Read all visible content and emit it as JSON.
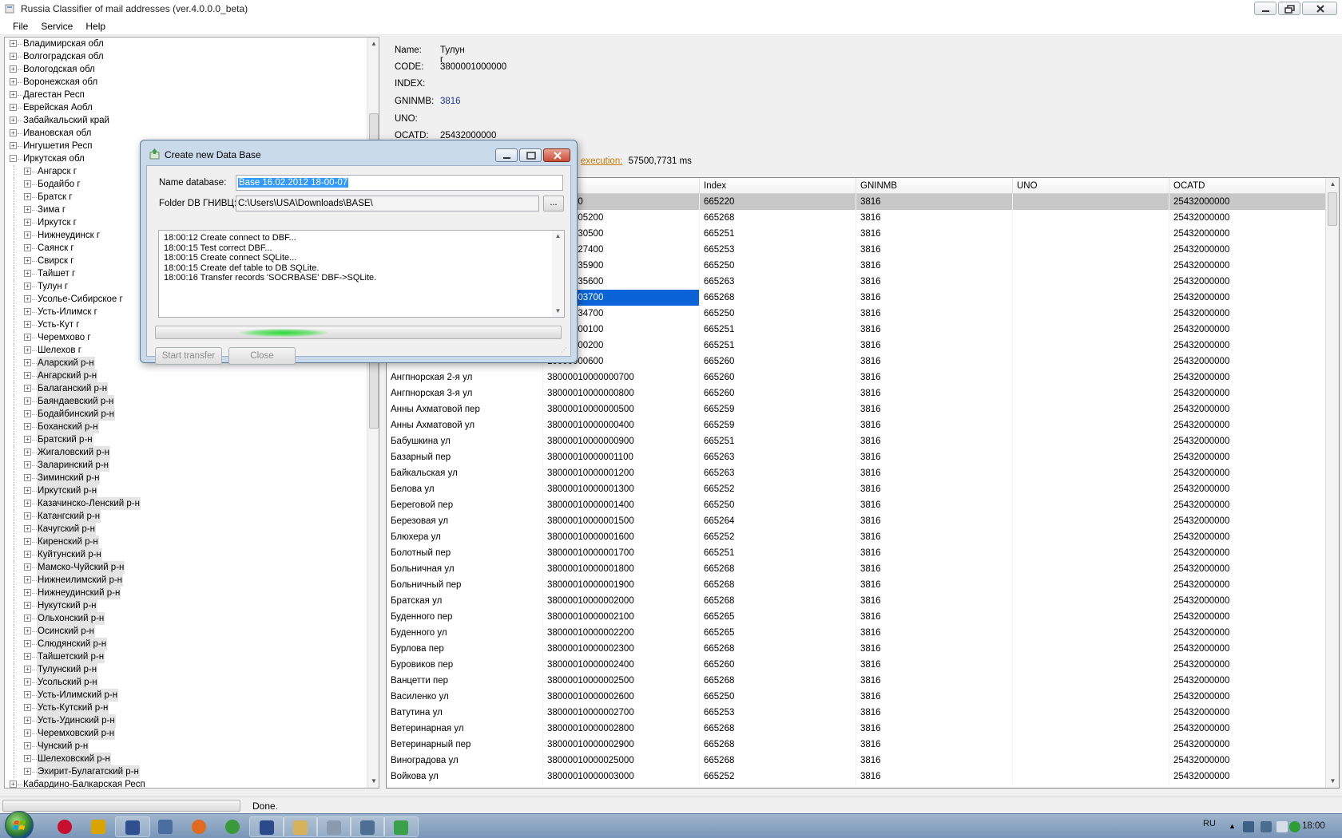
{
  "window": {
    "title": "Russia Classifier of mail addresses  (ver.4.0.0.0_beta)"
  },
  "menu": [
    "File",
    "Service",
    "Help"
  ],
  "tree": {
    "nodes": [
      {
        "label": "Владимирская обл",
        "level": 0,
        "expanded": false,
        "highlighted": false
      },
      {
        "label": "Волгоградская обл",
        "level": 0,
        "expanded": false,
        "highlighted": false
      },
      {
        "label": "Вологодская обл",
        "level": 0,
        "expanded": false,
        "highlighted": false
      },
      {
        "label": "Воронежская обл",
        "level": 0,
        "expanded": false,
        "highlighted": false
      },
      {
        "label": "Дагестан Респ",
        "level": 0,
        "expanded": false,
        "highlighted": false
      },
      {
        "label": "Еврейская Аобл",
        "level": 0,
        "expanded": false,
        "highlighted": false
      },
      {
        "label": "Забайкальский край",
        "level": 0,
        "expanded": false,
        "highlighted": false
      },
      {
        "label": "Ивановская обл",
        "level": 0,
        "expanded": false,
        "highlighted": false
      },
      {
        "label": "Ингушетия Респ",
        "level": 0,
        "expanded": false,
        "highlighted": false
      },
      {
        "label": "Иркутская обл",
        "level": 0,
        "expanded": true,
        "highlighted": false
      },
      {
        "label": "Ангарск г",
        "level": 1,
        "expanded": false,
        "highlighted": false
      },
      {
        "label": "Бодайбо г",
        "level": 1,
        "expanded": false,
        "highlighted": false
      },
      {
        "label": "Братск г",
        "level": 1,
        "expanded": false,
        "highlighted": false
      },
      {
        "label": "Зима г",
        "level": 1,
        "expanded": false,
        "highlighted": false
      },
      {
        "label": "Иркутск г",
        "level": 1,
        "expanded": false,
        "highlighted": false
      },
      {
        "label": "Нижнеудинск г",
        "level": 1,
        "expanded": false,
        "highlighted": false
      },
      {
        "label": "Саянск г",
        "level": 1,
        "expanded": false,
        "highlighted": false
      },
      {
        "label": "Свирск г",
        "level": 1,
        "expanded": false,
        "highlighted": false
      },
      {
        "label": "Тайшет г",
        "level": 1,
        "expanded": false,
        "highlighted": false
      },
      {
        "label": "Тулун г",
        "level": 1,
        "expanded": false,
        "highlighted": false
      },
      {
        "label": "Усолье-Сибирское г",
        "level": 1,
        "expanded": false,
        "highlighted": false
      },
      {
        "label": "Усть-Илимск г",
        "level": 1,
        "expanded": false,
        "highlighted": false
      },
      {
        "label": "Усть-Кут г",
        "level": 1,
        "expanded": false,
        "highlighted": false
      },
      {
        "label": "Черемхово г",
        "level": 1,
        "expanded": false,
        "highlighted": false
      },
      {
        "label": "Шелехов г",
        "level": 1,
        "expanded": false,
        "highlighted": false
      },
      {
        "label": "Аларский р-н",
        "level": 1,
        "expanded": false,
        "highlighted": true
      },
      {
        "label": "Ангарский р-н",
        "level": 1,
        "expanded": false,
        "highlighted": true
      },
      {
        "label": "Балаганский р-н",
        "level": 1,
        "expanded": false,
        "highlighted": true
      },
      {
        "label": "Баяндаевский р-н",
        "level": 1,
        "expanded": false,
        "highlighted": true
      },
      {
        "label": "Бодайбинский р-н",
        "level": 1,
        "expanded": false,
        "highlighted": true
      },
      {
        "label": "Боханский р-н",
        "level": 1,
        "expanded": false,
        "highlighted": true
      },
      {
        "label": "Братский р-н",
        "level": 1,
        "expanded": false,
        "highlighted": true
      },
      {
        "label": "Жигаловский р-н",
        "level": 1,
        "expanded": false,
        "highlighted": true
      },
      {
        "label": "Заларинский р-н",
        "level": 1,
        "expanded": false,
        "highlighted": true
      },
      {
        "label": "Зиминский р-н",
        "level": 1,
        "expanded": false,
        "highlighted": true
      },
      {
        "label": "Иркутский р-н",
        "level": 1,
        "expanded": false,
        "highlighted": true
      },
      {
        "label": "Казачинско-Ленский р-н",
        "level": 1,
        "expanded": false,
        "highlighted": true
      },
      {
        "label": "Катангский р-н",
        "level": 1,
        "expanded": false,
        "highlighted": true
      },
      {
        "label": "Качугский р-н",
        "level": 1,
        "expanded": false,
        "highlighted": true
      },
      {
        "label": "Киренский р-н",
        "level": 1,
        "expanded": false,
        "highlighted": true
      },
      {
        "label": "Куйтунский р-н",
        "level": 1,
        "expanded": false,
        "highlighted": true
      },
      {
        "label": "Мамско-Чуйский р-н",
        "level": 1,
        "expanded": false,
        "highlighted": true
      },
      {
        "label": "Нижнеилимский р-н",
        "level": 1,
        "expanded": false,
        "highlighted": true
      },
      {
        "label": "Нижнеудинский р-н",
        "level": 1,
        "expanded": false,
        "highlighted": true
      },
      {
        "label": "Нукутский р-н",
        "level": 1,
        "expanded": false,
        "highlighted": true
      },
      {
        "label": "Ольхонский р-н",
        "level": 1,
        "expanded": false,
        "highlighted": true
      },
      {
        "label": "Осинский р-н",
        "level": 1,
        "expanded": false,
        "highlighted": true
      },
      {
        "label": "Слюдянский р-н",
        "level": 1,
        "expanded": false,
        "highlighted": true
      },
      {
        "label": "Тайшетский р-н",
        "level": 1,
        "expanded": false,
        "highlighted": true
      },
      {
        "label": "Тулунский р-н",
        "level": 1,
        "expanded": false,
        "highlighted": true
      },
      {
        "label": "Усольский р-н",
        "level": 1,
        "expanded": false,
        "highlighted": true
      },
      {
        "label": "Усть-Илимский р-н",
        "level": 1,
        "expanded": false,
        "highlighted": true
      },
      {
        "label": "Усть-Кутский р-н",
        "level": 1,
        "expanded": false,
        "highlighted": true
      },
      {
        "label": "Усть-Удинский р-н",
        "level": 1,
        "expanded": false,
        "highlighted": true
      },
      {
        "label": "Черемховский р-н",
        "level": 1,
        "expanded": false,
        "highlighted": true
      },
      {
        "label": "Чунский р-н",
        "level": 1,
        "expanded": false,
        "highlighted": true
      },
      {
        "label": "Шелеховский р-н",
        "level": 1,
        "expanded": false,
        "highlighted": true
      },
      {
        "label": "Эхирит-Булагатский р-н",
        "level": 1,
        "expanded": false,
        "highlighted": true
      },
      {
        "label": "Кабардино-Балкарская Респ",
        "level": 0,
        "expanded": false,
        "highlighted": false
      }
    ]
  },
  "info": {
    "name_label": "Name:",
    "name_value": "Тулун г",
    "code_label": "CODE:",
    "code_value": "3800001000000",
    "index_label": "INDEX:",
    "index_value": "",
    "gninmb_label": "GNINMB:",
    "gninmb_value": "3816",
    "uno_label": "UNO:",
    "uno_value": "",
    "ocatd_label": "OCATD:",
    "ocatd_value": "25432000000",
    "exec_label": "execution:",
    "exec_value": "57500,7731 ms"
  },
  "grid": {
    "columns": [
      "",
      "",
      "Index",
      "GNINMB",
      "UNO",
      "OCATD"
    ],
    "rows": [
      [
        "",
        "1000100",
        "665220",
        "3816",
        "",
        "25432000000"
      ],
      [
        "",
        "10000005200",
        "665268",
        "3816",
        "",
        "25432000000"
      ],
      [
        "",
        "10000030500",
        "665251",
        "3816",
        "",
        "25432000000"
      ],
      [
        "",
        "10000027400",
        "665253",
        "3816",
        "",
        "25432000000"
      ],
      [
        "",
        "10000035900",
        "665250",
        "3816",
        "",
        "25432000000"
      ],
      [
        "",
        "10000035600",
        "665263",
        "3816",
        "",
        "25432000000"
      ],
      [
        "",
        "10000003700",
        "665268",
        "3816",
        "",
        "25432000000"
      ],
      [
        "",
        "10000034700",
        "665250",
        "3816",
        "",
        "25432000000"
      ],
      [
        "",
        "10000000100",
        "665251",
        "3816",
        "",
        "25432000000"
      ],
      [
        "",
        "10000000200",
        "665251",
        "3816",
        "",
        "25432000000"
      ],
      [
        "",
        "10000000600",
        "665260",
        "3816",
        "",
        "25432000000"
      ],
      [
        "Ангпнорская 2-я ул",
        "38000010000000700",
        "665260",
        "3816",
        "",
        "25432000000"
      ],
      [
        "Ангпнорская 3-я ул",
        "38000010000000800",
        "665260",
        "3816",
        "",
        "25432000000"
      ],
      [
        "Анны Ахматовой пер",
        "38000010000000500",
        "665259",
        "3816",
        "",
        "25432000000"
      ],
      [
        "Анны Ахматовой ул",
        "38000010000000400",
        "665259",
        "3816",
        "",
        "25432000000"
      ],
      [
        "Бабушкина ул",
        "38000010000000900",
        "665251",
        "3816",
        "",
        "25432000000"
      ],
      [
        "Базарный пер",
        "38000010000001100",
        "665263",
        "3816",
        "",
        "25432000000"
      ],
      [
        "Байкальская ул",
        "38000010000001200",
        "665263",
        "3816",
        "",
        "25432000000"
      ],
      [
        "Белова ул",
        "38000010000001300",
        "665252",
        "3816",
        "",
        "25432000000"
      ],
      [
        "Береговой пер",
        "38000010000001400",
        "665250",
        "3816",
        "",
        "25432000000"
      ],
      [
        "Березовая ул",
        "38000010000001500",
        "665264",
        "3816",
        "",
        "25432000000"
      ],
      [
        "Блюхера ул",
        "38000010000001600",
        "665252",
        "3816",
        "",
        "25432000000"
      ],
      [
        "Болотный пер",
        "38000010000001700",
        "665251",
        "3816",
        "",
        "25432000000"
      ],
      [
        "Больничная ул",
        "38000010000001800",
        "665268",
        "3816",
        "",
        "25432000000"
      ],
      [
        "Больничный пер",
        "38000010000001900",
        "665268",
        "3816",
        "",
        "25432000000"
      ],
      [
        "Братская ул",
        "38000010000002000",
        "665268",
        "3816",
        "",
        "25432000000"
      ],
      [
        "Буденного пер",
        "38000010000002100",
        "665265",
        "3816",
        "",
        "25432000000"
      ],
      [
        "Буденного ул",
        "38000010000002200",
        "665265",
        "3816",
        "",
        "25432000000"
      ],
      [
        "Бурлова пер",
        "38000010000002300",
        "665268",
        "3816",
        "",
        "25432000000"
      ],
      [
        "Буровиков пер",
        "38000010000002400",
        "665260",
        "3816",
        "",
        "25432000000"
      ],
      [
        "Ванцетти пер",
        "38000010000002500",
        "665268",
        "3816",
        "",
        "25432000000"
      ],
      [
        "Василенко ул",
        "38000010000002600",
        "665250",
        "3816",
        "",
        "25432000000"
      ],
      [
        "Ватутина ул",
        "38000010000002700",
        "665253",
        "3816",
        "",
        "25432000000"
      ],
      [
        "Ветеринарная ул",
        "38000010000002800",
        "665268",
        "3816",
        "",
        "25432000000"
      ],
      [
        "Ветеринарный пер",
        "38000010000002900",
        "665268",
        "3816",
        "",
        "25432000000"
      ],
      [
        "Виноградова ул",
        "38000010000025000",
        "665268",
        "3816",
        "",
        "25432000000"
      ],
      [
        "Войкова ул",
        "38000010000003000",
        "665252",
        "3816",
        "",
        "25432000000"
      ]
    ]
  },
  "status": {
    "text": "Done."
  },
  "dialog": {
    "title": "Create new Data Base",
    "name_label": "Name database:",
    "name_value": "Base 16.02.2012 18-00-07",
    "folder_label": "Folder DB ГНИВЦ:",
    "folder_value": "C:\\Users\\USA\\Downloads\\BASE\\",
    "browse_label": "...",
    "log": [
      "18:00:12 Create connect to DBF...",
      "18:00:15 Test correct DBF...",
      "18:00:15 Create connect SQLite...",
      "18:00:15 Create def table to DB SQLite.",
      "18:00:16 Transfer records 'SOCRBASE' DBF->SQLite."
    ],
    "start_label": "Start transfer",
    "close_label": "Close"
  },
  "taskbar": {
    "lang": "RU",
    "clock": "18:00",
    "items": [
      "opera-icon",
      "app-icon",
      "infinity-icon",
      "connection-icon",
      "firefox-icon",
      "chrome-icon",
      "save-icon",
      "folder-icon",
      "db-icon",
      "edit-icon",
      "classifier-icon"
    ]
  }
}
